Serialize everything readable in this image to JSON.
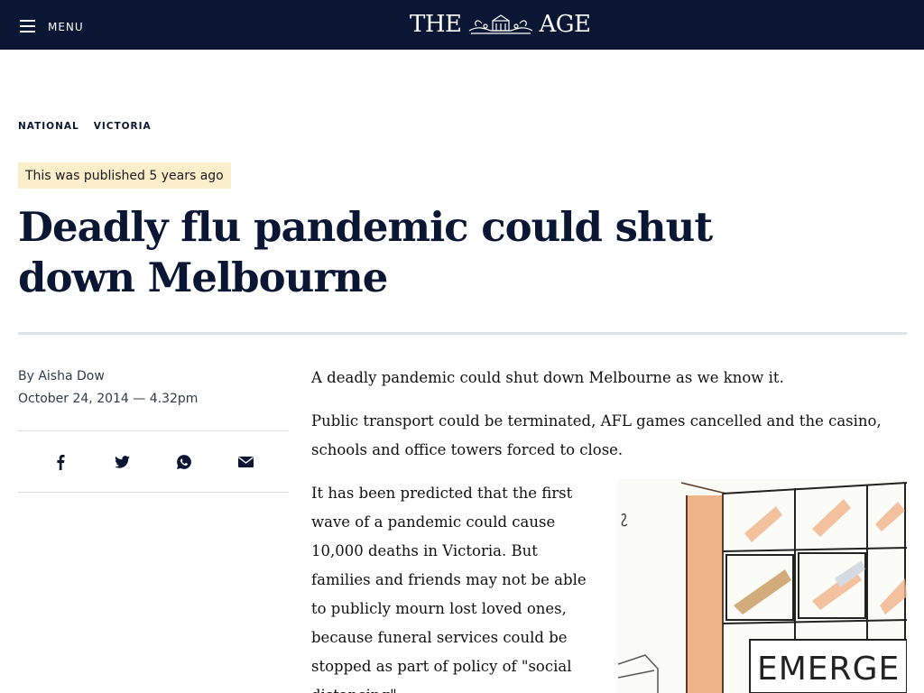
{
  "header": {
    "menu_label": "MENU",
    "masthead_left": "THE",
    "masthead_right": "AGE"
  },
  "sections": [
    "NATIONAL",
    "VICTORIA"
  ],
  "published_badge": "This was published 5 years ago",
  "headline": "Deadly flu pandemic could shut down Melbourne",
  "byline": {
    "prefix": "By ",
    "author": "Aisha Dow",
    "date": "October 24, 2014 — 4.32pm"
  },
  "share_icons": [
    "facebook-icon",
    "twitter-icon",
    "whatsapp-icon",
    "email-icon"
  ],
  "article": {
    "paragraphs": [
      "A deadly pandemic could shut down Melbourne as we know it.",
      "Public transport could be terminated, AFL games cancelled and the casino, schools and office towers forced to close.",
      "It has been predicted that the first wave of a pandemic could cause 10,000 deaths in Victoria. But families and friends may not be able to publicly mourn lost loved ones, because funeral services could be stopped as part of policy of \"social distancing\"."
    ],
    "image_sign_text": "EMERGE"
  },
  "colors": {
    "navy": "#0a1633",
    "badge_bg": "#fbeecb"
  }
}
